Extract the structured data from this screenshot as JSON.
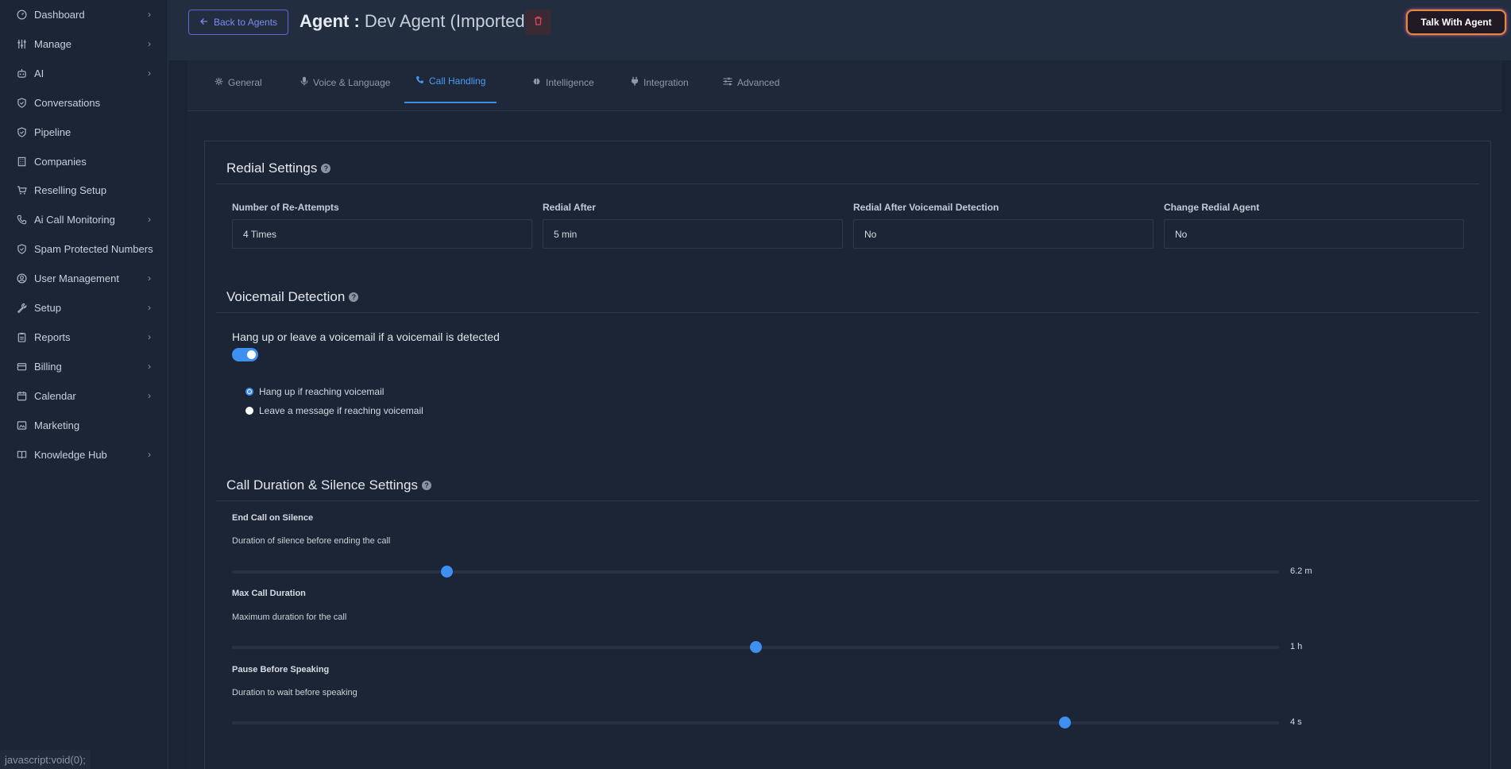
{
  "sidebar": {
    "items": [
      {
        "label": "Dashboard",
        "icon": "gauge-icon",
        "chevron": true
      },
      {
        "label": "Manage",
        "icon": "sliders-icon",
        "chevron": true
      },
      {
        "label": "AI",
        "icon": "robot-icon",
        "chevron": true
      },
      {
        "label": "Conversations",
        "icon": "shield-icon",
        "chevron": false
      },
      {
        "label": "Pipeline",
        "icon": "shield-icon",
        "chevron": false
      },
      {
        "label": "Companies",
        "icon": "building-icon",
        "chevron": false
      },
      {
        "label": "Reselling Setup",
        "icon": "cart-icon",
        "chevron": false
      },
      {
        "label": "Ai Call Monitoring",
        "icon": "phone-icon",
        "chevron": true
      },
      {
        "label": "Spam Protected Numbers",
        "icon": "shield-icon",
        "chevron": false
      },
      {
        "label": "User Management",
        "icon": "user-circle-icon",
        "chevron": true
      },
      {
        "label": "Setup",
        "icon": "wrench-icon",
        "chevron": true
      },
      {
        "label": "Reports",
        "icon": "clipboard-icon",
        "chevron": true
      },
      {
        "label": "Billing",
        "icon": "credit-card-icon",
        "chevron": true
      },
      {
        "label": "Calendar",
        "icon": "calendar-icon",
        "chevron": true
      },
      {
        "label": "Marketing",
        "icon": "image-icon",
        "chevron": false
      },
      {
        "label": "Knowledge Hub",
        "icon": "book-icon",
        "chevron": true
      }
    ],
    "chevron_glyph": "›"
  },
  "statusbar": {
    "text": "javascript:void(0);"
  },
  "header": {
    "back_label": "Back to Agents",
    "title_label": "Agent :",
    "agent_name": "Dev Agent (Imported)",
    "talk_label": "Talk With Agent"
  },
  "tabs": [
    {
      "label": "General",
      "icon": "gear-icon",
      "active": false
    },
    {
      "label": "Voice & Language",
      "icon": "microphone-icon",
      "active": false
    },
    {
      "label": "Call Handling",
      "icon": "phone-icon",
      "active": true
    },
    {
      "label": "Intelligence",
      "icon": "brain-icon",
      "active": false
    },
    {
      "label": "Integration",
      "icon": "plug-icon",
      "active": false
    },
    {
      "label": "Advanced",
      "icon": "sliders-icon",
      "active": false
    }
  ],
  "redial": {
    "title": "Redial Settings",
    "fields": [
      {
        "label": "Number of Re-Attempts",
        "value": "4 Times"
      },
      {
        "label": "Redial After",
        "value": "5 min"
      },
      {
        "label": "Redial After Voicemail Detection",
        "value": "No"
      },
      {
        "label": "Change Redial Agent",
        "value": "No"
      }
    ]
  },
  "voicemail": {
    "title": "Voicemail Detection",
    "question": "Hang up or leave a voicemail if a voicemail is detected",
    "toggle_on": true,
    "options": [
      {
        "label": "Hang up if reaching voicemail",
        "checked": true
      },
      {
        "label": "Leave a message if reaching voicemail",
        "checked": false
      }
    ]
  },
  "duration": {
    "title": "Call Duration & Silence Settings",
    "sliders": [
      {
        "title": "End Call on Silence",
        "desc": "Duration of silence before ending the call",
        "value_label": "6.2 m",
        "fraction": 0.205
      },
      {
        "title": "Max Call Duration",
        "desc": "Maximum duration for the call",
        "value_label": "1 h",
        "fraction": 0.5
      },
      {
        "title": "Pause Before Speaking",
        "desc": "Duration to wait before speaking",
        "value_label": "4 s",
        "fraction": 0.795
      }
    ]
  },
  "colors": {
    "accent": "#3d8ff0",
    "danger": "#e0445a",
    "talk_border": "#e08a3a"
  }
}
